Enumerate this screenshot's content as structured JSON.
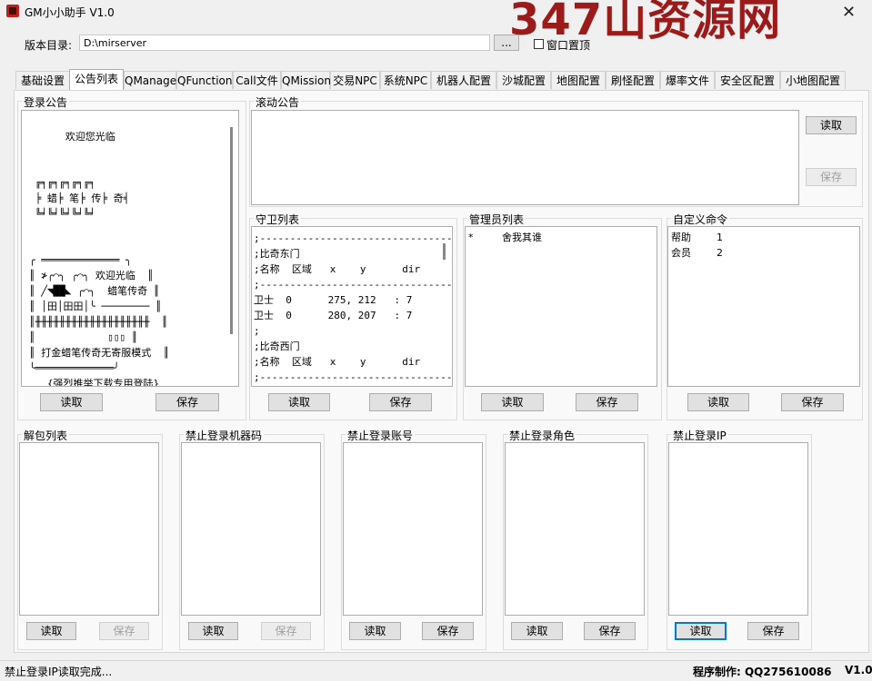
{
  "window": {
    "title": "GM小小助手 V1.0",
    "watermark": "347山资源网",
    "close_glyph": "✕"
  },
  "settings": {
    "version_dir_label": "版本目录:",
    "version_dir_value": "D:\\mirserver",
    "browse_label": "...",
    "topmost_label": "窗口置顶",
    "topmost_checked": false
  },
  "tabs": [
    {
      "label": "基础设置"
    },
    {
      "label": "公告列表"
    },
    {
      "label": "QManage"
    },
    {
      "label": "QFunction"
    },
    {
      "label": "Call文件"
    },
    {
      "label": "QMission"
    },
    {
      "label": "交易NPC"
    },
    {
      "label": "系统NPC"
    },
    {
      "label": "机器人配置"
    },
    {
      "label": "沙城配置"
    },
    {
      "label": "地图配置"
    },
    {
      "label": "刷怪配置"
    },
    {
      "label": "爆率文件"
    },
    {
      "label": "安全区配置"
    },
    {
      "label": "小地图配置"
    }
  ],
  "active_tab_index": 1,
  "login_notice": {
    "label": "登录公告",
    "lines": [
      "      欢迎您光临",
      "",
      "",
      " ╔╕╔╕╔╕╔╕╔╕",
      " ╞ 蜡╞ 笔╞ 传╞ 奇╡",
      " ╚╛╚╛╚╛╚╛╚╛",
      "",
      "",
      "╭ ═════════════ ╮",
      "║ ≯╭⌒╮ ╭⌒╮ 欢迎光临  ║",
      "║ ╱◥██◣ ╭⌒╮  蜡笔传奇 ║",
      "║ │田│田田│╰ ──────── ║",
      "║╫╫╫╫╫╫╫╫╫╫╫╫╫╫╫╫╫╫╫  ║",
      "║            ▯▯▯ ║",
      "║ 打金蜡笔传奇无寄服模式  ║",
      "╰═════════════╯",
      "   {强烈推举下载专用登陆}",
      "",
      " ╔╕╔╕╔╕╔╕╔╕"
    ],
    "read_label": "读取",
    "save_label": "保存"
  },
  "scroll_notice": {
    "label": "滚动公告",
    "text": "",
    "read_label": "读取",
    "save_label": "保存"
  },
  "guard_list": {
    "label": "守卫列表",
    "lines": [
      ";-------------------------------------",
      ";比奇东门",
      ";名称  区域   x    y      dir",
      ";----------------------------------",
      "卫士  0      275, 212   : 7",
      "卫士  0      280, 207   : 7",
      ";",
      ";比奇西门",
      ";名称  区域   x    y      dir",
      ";----------------------------------"
    ],
    "read_label": "读取",
    "save_label": "保存"
  },
  "admin_list": {
    "label": "管理员列表",
    "lines": [
      "*         舍我其谁"
    ],
    "read_label": "读取",
    "save_label": "保存"
  },
  "custom_cmd": {
    "label": "自定义命令",
    "lines": [
      "帮助        1",
      "会员        2"
    ],
    "read_label": "读取",
    "save_label": "保存"
  },
  "unpack_list": {
    "label": "解包列表",
    "read_label": "读取",
    "save_label": "保存",
    "save_disabled": true
  },
  "ban_machine": {
    "label": "禁止登录机器码",
    "read_label": "读取",
    "save_label": "保存",
    "save_disabled": true
  },
  "ban_account": {
    "label": "禁止登录账号",
    "read_label": "读取",
    "save_label": "保存"
  },
  "ban_role": {
    "label": "禁止登录角色",
    "read_label": "读取",
    "save_label": "保存"
  },
  "ban_ip": {
    "label": "禁止登录IP",
    "read_label": "读取",
    "save_label": "保存"
  },
  "status": {
    "message": "禁止登录IP读取完成...",
    "author": "程序制作:   QQ275610086",
    "version": "V1.0"
  }
}
